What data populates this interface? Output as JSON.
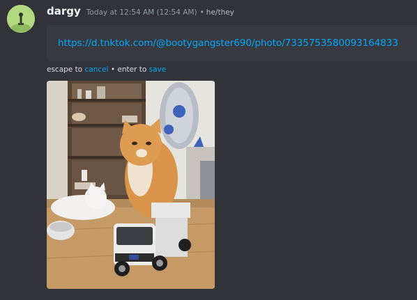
{
  "author": {
    "username": "dargy",
    "timestamp": "Today at 12:54 AM (12:54 AM)",
    "separator": "•",
    "pronouns": "he/they"
  },
  "edit": {
    "value": "https://d.tnktok.com/@bootygangster690/photo/7335753580093164833"
  },
  "hint": {
    "prefix": "escape to ",
    "cancel_label": "cancel",
    "middle": " • enter to ",
    "save_label": "save"
  },
  "colors": {
    "background": "#313338",
    "input_background": "#383a40",
    "link": "#00a8fc",
    "username": "#f2f3f5",
    "muted": "#949ba4"
  },
  "attachment": {
    "type": "image",
    "content": "photo"
  }
}
